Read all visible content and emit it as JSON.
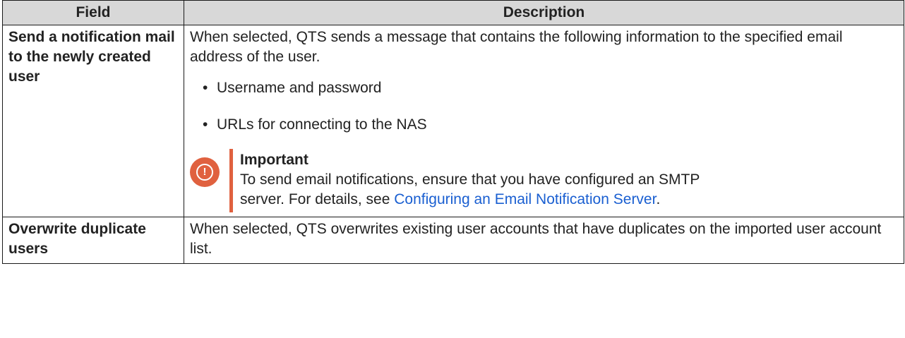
{
  "table": {
    "headers": {
      "field": "Field",
      "description": "Description"
    },
    "rows": [
      {
        "field": "Send a notification mail to the newly created user",
        "description": "When selected, QTS sends a message that contains the following information to the specified email address of the user.",
        "bullets": [
          "Username and password",
          "URLs for connecting to the NAS"
        ],
        "note": {
          "icon": "important-icon",
          "title": "Important",
          "text_before_link": "To send email notifications, ensure that you have configured an SMTP server. For details, see ",
          "link_text": "Configuring an Email Notification Server",
          "text_after_link": "."
        }
      },
      {
        "field": "Overwrite duplicate users",
        "description": "When selected, QTS overwrites existing user accounts that have duplicates on the imported user account list."
      }
    ]
  },
  "colors": {
    "header_bg": "#d8d8d8",
    "note_accent": "#e0613f",
    "link": "#1a5fd1"
  }
}
